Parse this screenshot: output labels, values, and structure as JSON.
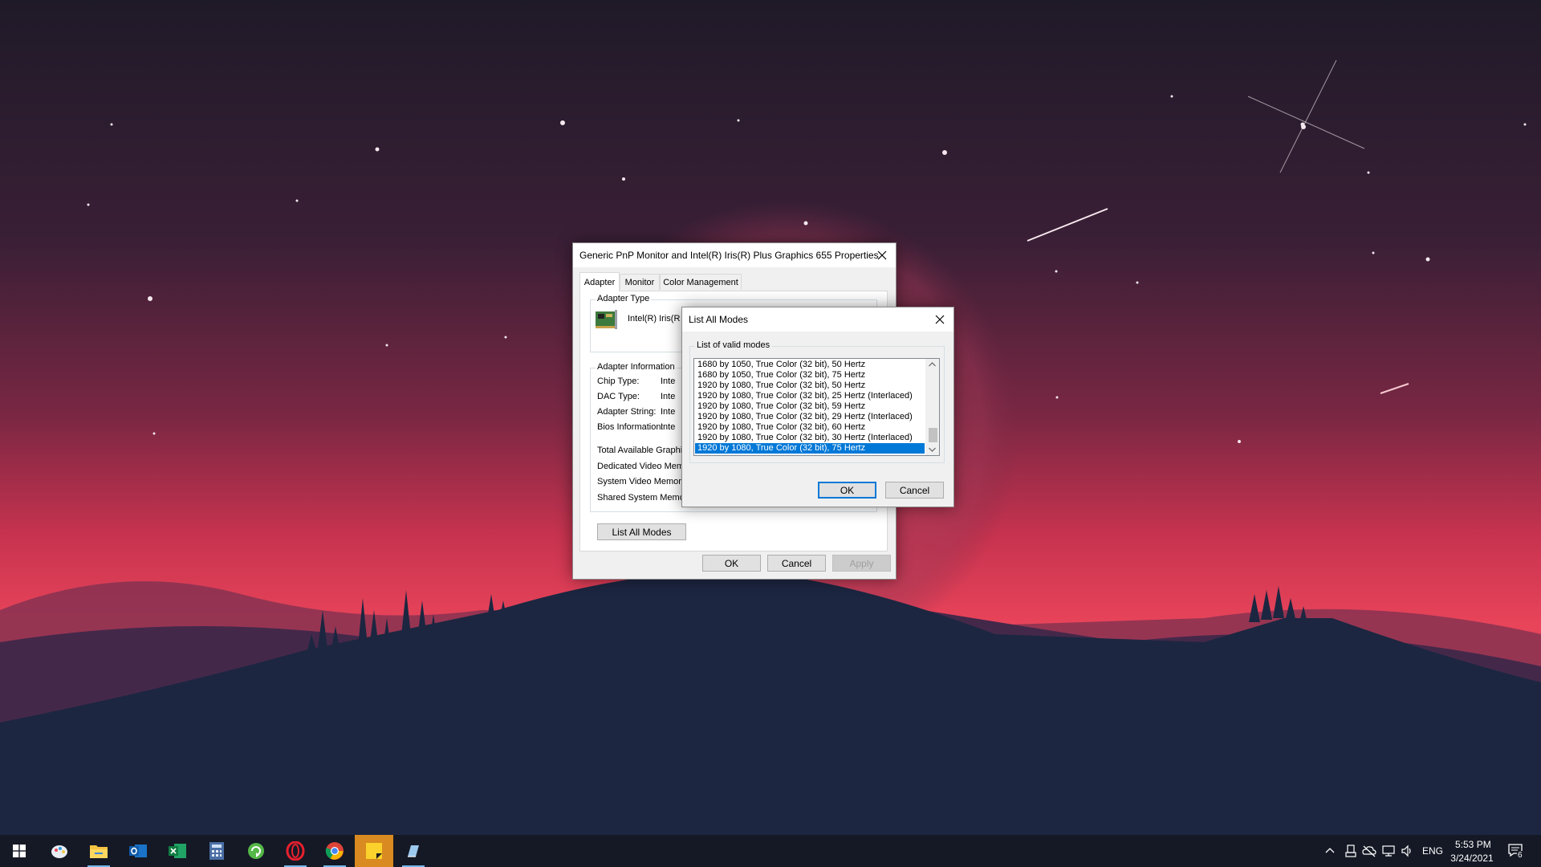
{
  "properties_dialog": {
    "title": "Generic PnP Monitor and Intel(R) Iris(R) Plus Graphics 655 Properties",
    "tabs": [
      "Adapter",
      "Monitor",
      "Color Management"
    ],
    "adapter_type_label": "Adapter Type",
    "adapter_name": "Intel(R) Iris(R",
    "adapter_info_label": "Adapter Information",
    "info_rows": [
      {
        "label": "Chip Type:",
        "value": "Inte"
      },
      {
        "label": "DAC Type:",
        "value": "Inte"
      },
      {
        "label": "Adapter String:",
        "value": "Inte"
      },
      {
        "label": "Bios Information:",
        "value": "Inte"
      }
    ],
    "memory_rows": [
      "Total Available Graphic",
      "Dedicated Video Memo",
      "System Video Memory",
      "Shared System Memor"
    ],
    "list_all_modes_label": "List All Modes",
    "ok_label": "OK",
    "cancel_label": "Cancel",
    "apply_label": "Apply"
  },
  "modes_dialog": {
    "title": "List All Modes",
    "group_label": "List of valid modes",
    "modes": [
      "1680 by 1050, True Color (32 bit), 50 Hertz",
      "1680 by 1050, True Color (32 bit), 75 Hertz",
      "1920 by 1080, True Color (32 bit), 50 Hertz",
      "1920 by 1080, True Color (32 bit), 25 Hertz (Interlaced)",
      "1920 by 1080, True Color (32 bit), 59 Hertz",
      "1920 by 1080, True Color (32 bit), 29 Hertz (Interlaced)",
      "1920 by 1080, True Color (32 bit), 60 Hertz",
      "1920 by 1080, True Color (32 bit), 30 Hertz (Interlaced)",
      "1920 by 1080, True Color (32 bit), 75 Hertz"
    ],
    "selected_index": 8,
    "ok_label": "OK",
    "cancel_label": "Cancel"
  },
  "taskbar": {
    "apps": [
      {
        "name": "start-button",
        "icon": "windows-logo"
      },
      {
        "name": "paint-3d",
        "icon": "paint-palette-icon"
      },
      {
        "name": "file-explorer",
        "icon": "folder-icon",
        "running": true
      },
      {
        "name": "outlook",
        "icon": "outlook-icon"
      },
      {
        "name": "excel",
        "icon": "excel-icon"
      },
      {
        "name": "calculator",
        "icon": "calculator-icon"
      },
      {
        "name": "sync-app",
        "icon": "green-refresh-icon"
      },
      {
        "name": "opera",
        "icon": "opera-icon",
        "running": true
      },
      {
        "name": "chrome",
        "icon": "chrome-icon",
        "running": true
      },
      {
        "name": "sticky-notes",
        "icon": "sticky-note-icon",
        "active": true
      },
      {
        "name": "settings-app",
        "icon": "pen-icon",
        "running": true
      }
    ],
    "language": "ENG",
    "time": "5:53 PM",
    "date": "3/24/2021",
    "notification_count": "6"
  },
  "colors": {
    "accent": "#0078d7",
    "taskbar": "#141925",
    "sky_top": "#241a2c",
    "sky_glow": "#e23a55",
    "mountain": "#1c2640"
  }
}
